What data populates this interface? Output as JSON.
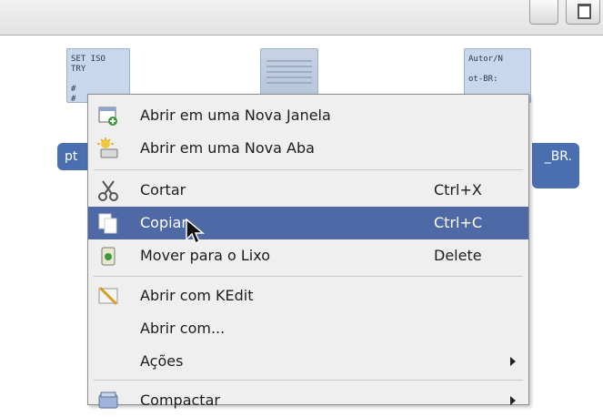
{
  "desktop": {
    "files": [
      {
        "preview": "SET ISO\nTRY\n\n#\n#",
        "label": "pt"
      },
      {
        "preview": "",
        "label": ""
      },
      {
        "preview": "Autor/N\n\not-BR:",
        "label": "_BR."
      }
    ]
  },
  "context_menu": {
    "items": [
      {
        "label": "Abrir em uma Nova Janela",
        "shortcut": "",
        "icon": "new-window-icon"
      },
      {
        "label": "Abrir em uma Nova Aba",
        "shortcut": "",
        "icon": "new-tab-icon"
      },
      {
        "label": "Cortar",
        "shortcut": "Ctrl+X",
        "icon": "cut-icon"
      },
      {
        "label": "Copiar",
        "shortcut": "Ctrl+C",
        "icon": "copy-icon",
        "highlighted": true
      },
      {
        "label": "Mover para o Lixo",
        "shortcut": "Delete",
        "icon": "trash-icon"
      },
      {
        "label": "Abrir com KEdit",
        "shortcut": "",
        "icon": "kedit-icon"
      },
      {
        "label": "Abrir com...",
        "shortcut": "",
        "icon": ""
      },
      {
        "label": "Ações",
        "shortcut": "",
        "icon": "",
        "submenu": true
      },
      {
        "label": "Compactar",
        "shortcut": "",
        "icon": "archive-icon",
        "submenu": true
      }
    ]
  },
  "colors": {
    "highlight": "#4f69a6",
    "menu_bg": "#efefef",
    "file_label_bg": "#4a6fb0"
  }
}
